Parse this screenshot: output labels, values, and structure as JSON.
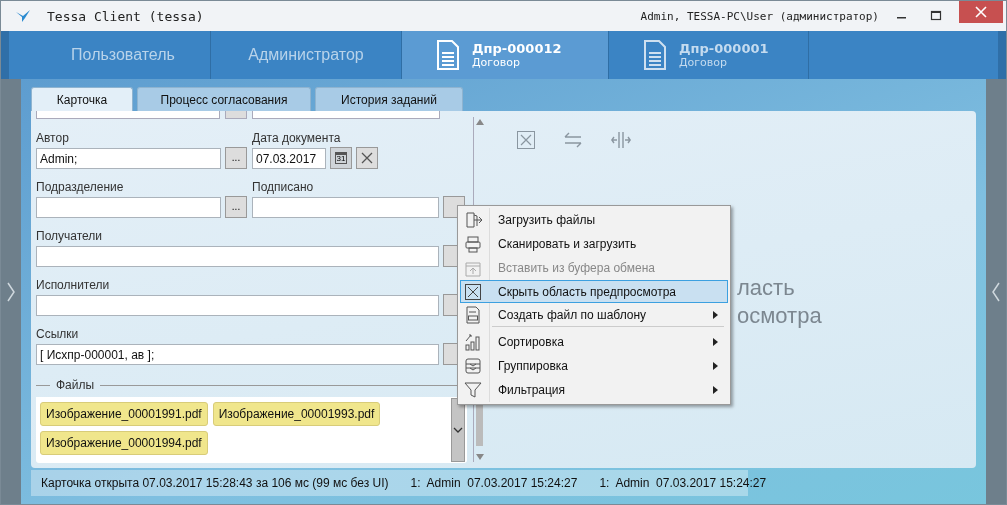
{
  "window": {
    "title": "Tessa Client (tessa)",
    "user": "Admin, TESSA-PC\\User (администратор)"
  },
  "nav_tabs": [
    {
      "kind": "section",
      "label": "Пользователь",
      "selected": false
    },
    {
      "kind": "section",
      "label": "Администратор",
      "selected": false
    },
    {
      "kind": "document",
      "title": "Дпр-000012",
      "subtitle": "Договор",
      "selected": true
    },
    {
      "kind": "document",
      "title": "Дпр-000001",
      "subtitle": "Договор",
      "selected": false
    }
  ],
  "card_tabs": [
    {
      "label": "Карточка",
      "selected": true
    },
    {
      "label": "Процесс согласования",
      "selected": false
    },
    {
      "label": "История заданий",
      "selected": false
    }
  ],
  "form_rows": [
    [
      {
        "kind": "half",
        "label": "Автор",
        "value": "Admin;",
        "button_label": "..."
      },
      {
        "kind": "date",
        "label": "Дата документа",
        "value": "07.03.2017",
        "calendar_label": "31"
      }
    ],
    [
      {
        "kind": "half",
        "label": "Подразделение",
        "button_label": "..."
      },
      {
        "kind": "half_wide",
        "label": "Подписано"
      }
    ],
    [
      {
        "kind": "full",
        "label": "Получатели"
      }
    ],
    [
      {
        "kind": "full",
        "label": "Исполнители"
      }
    ],
    [
      {
        "kind": "full",
        "label": "Ссылки",
        "value": "[ Исхпр-000001, ав ];"
      }
    ]
  ],
  "files": {
    "legend": "Файлы",
    "items": [
      "Изображение_00001991.pdf",
      "Изображение_00001993.pdf",
      "Изображение_00001994.pdf"
    ]
  },
  "preview": {
    "text_lines": [
      "ласть",
      "осмотра"
    ]
  },
  "context_menu": [
    {
      "label": "Загрузить файлы",
      "disabled": false,
      "selected": false,
      "submenu": false,
      "separator_after": false
    },
    {
      "label": "Сканировать и загрузить",
      "disabled": false,
      "selected": false,
      "submenu": false,
      "separator_after": false
    },
    {
      "label": "Вставить из буфера обмена",
      "disabled": true,
      "selected": false,
      "submenu": false,
      "separator_after": false
    },
    {
      "label": "Скрыть область предпросмотра",
      "disabled": false,
      "selected": true,
      "submenu": false,
      "separator_after": false
    },
    {
      "label": "Создать файл по шаблону",
      "disabled": false,
      "selected": false,
      "submenu": true,
      "separator_after": true
    },
    {
      "label": "Сортировка",
      "disabled": false,
      "selected": false,
      "submenu": true,
      "separator_after": false
    },
    {
      "label": "Группировка",
      "disabled": false,
      "selected": false,
      "submenu": true,
      "separator_after": false
    },
    {
      "label": "Фильтрация",
      "disabled": false,
      "selected": false,
      "submenu": true,
      "separator_after": false
    }
  ],
  "status_bar": {
    "message": "Карточка открыта 07.03.2017 15:28:43 за 106 мс (99 мс без UI)",
    "entries": [
      "1:  Admin  07.03.2017 15:24:27",
      "1:  Admin  07.03.2017 15:24:27"
    ]
  }
}
